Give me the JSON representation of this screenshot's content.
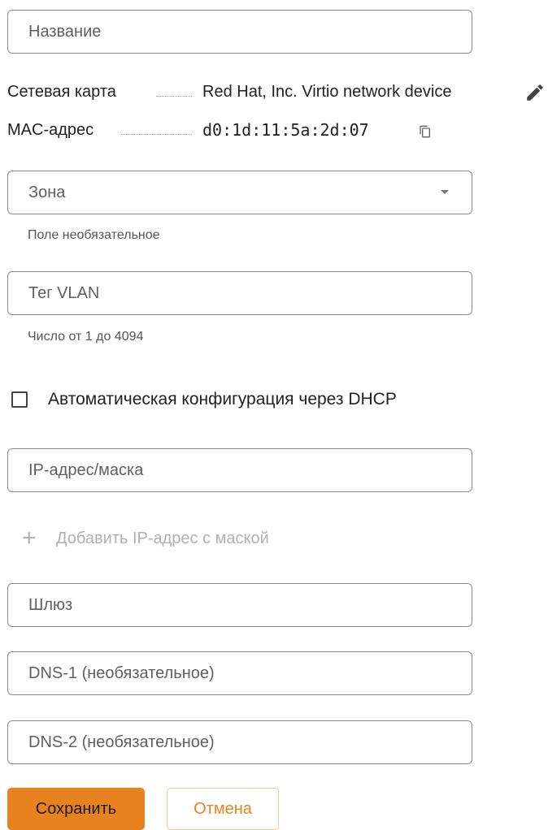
{
  "form": {
    "name_placeholder": "Название",
    "network_card": {
      "label": "Сетевая карта",
      "value": "Red Hat, Inc. Virtio network device",
      "edit_icon": "pencil-icon"
    },
    "mac": {
      "label": "MAC-адрес",
      "value": "d0:1d:11:5a:2d:07",
      "copy_icon": "copy-icon"
    },
    "zone": {
      "placeholder": "Зона",
      "helper": "Поле необязательное"
    },
    "vlan": {
      "placeholder": "Тег VLAN",
      "helper": "Число от 1 до 4094"
    },
    "dhcp": {
      "label": "Автоматическая конфигурация через DHCP",
      "checked": false
    },
    "ip_mask_placeholder": "IP-адрес/маска",
    "add_ip": {
      "icon": "+",
      "label": "Добавить IP-адрес с маской"
    },
    "gateway_placeholder": "Шлюз",
    "dns1_placeholder": "DNS-1 (необязательное)",
    "dns2_placeholder": "DNS-2 (необязательное)"
  },
  "actions": {
    "save_label": "Сохранить",
    "cancel_label": "Отмена"
  },
  "colors": {
    "accent": "#e8821e",
    "border": "#8a8a8a"
  }
}
